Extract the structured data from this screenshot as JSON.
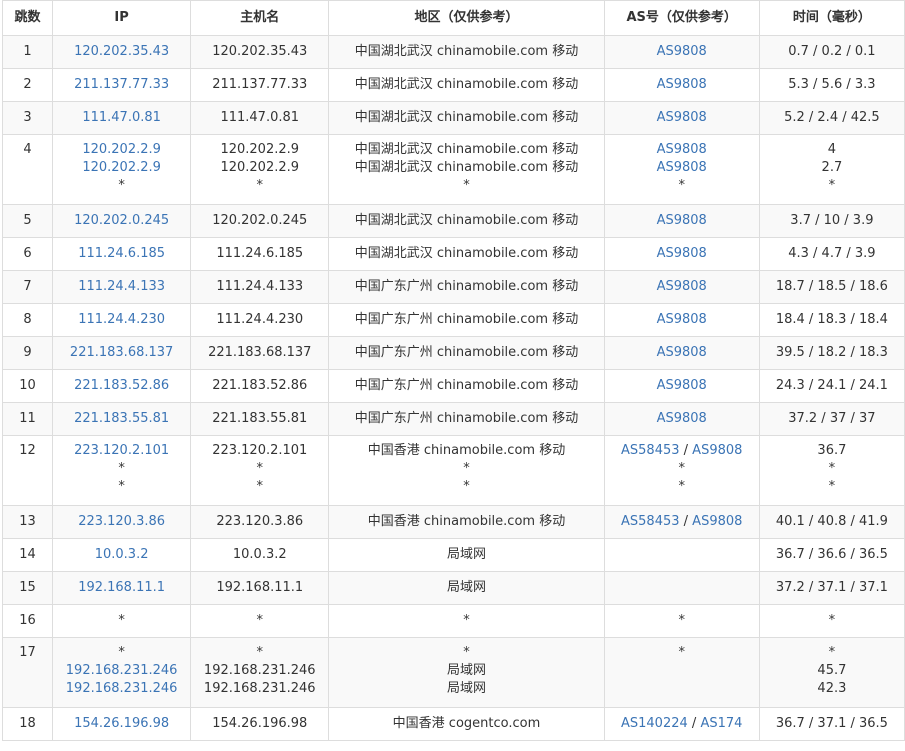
{
  "table": {
    "headers": {
      "hop": "跳数",
      "ip": "IP",
      "hostname": "主机名",
      "region": "地区（仅供参考）",
      "as": "AS号（仅供参考）",
      "time": "时间（毫秒）"
    },
    "rows": [
      {
        "hop": "1",
        "ip": [
          "120.202.35.43"
        ],
        "host": [
          "120.202.35.43"
        ],
        "region": [
          "中国湖北武汉 chinamobile.com 移动"
        ],
        "as": [
          [
            "AS9808"
          ]
        ],
        "time": [
          "0.7 / 0.2 / 0.1"
        ]
      },
      {
        "hop": "2",
        "ip": [
          "211.137.77.33"
        ],
        "host": [
          "211.137.77.33"
        ],
        "region": [
          "中国湖北武汉 chinamobile.com 移动"
        ],
        "as": [
          [
            "AS9808"
          ]
        ],
        "time": [
          "5.3 / 5.6 / 3.3"
        ]
      },
      {
        "hop": "3",
        "ip": [
          "111.47.0.81"
        ],
        "host": [
          "111.47.0.81"
        ],
        "region": [
          "中国湖北武汉 chinamobile.com 移动"
        ],
        "as": [
          [
            "AS9808"
          ]
        ],
        "time": [
          "5.2 / 2.4 / 42.5"
        ]
      },
      {
        "hop": "4",
        "ip": [
          "120.202.2.9",
          "120.202.2.9",
          "*"
        ],
        "host": [
          "120.202.2.9",
          "120.202.2.9",
          "*"
        ],
        "region": [
          "中国湖北武汉 chinamobile.com 移动",
          "中国湖北武汉 chinamobile.com 移动",
          "*"
        ],
        "as": [
          [
            "AS9808"
          ],
          [
            "AS9808"
          ],
          [
            "*"
          ]
        ],
        "time": [
          "4",
          "2.7",
          "*"
        ]
      },
      {
        "hop": "5",
        "ip": [
          "120.202.0.245"
        ],
        "host": [
          "120.202.0.245"
        ],
        "region": [
          "中国湖北武汉 chinamobile.com 移动"
        ],
        "as": [
          [
            "AS9808"
          ]
        ],
        "time": [
          "3.7 / 10 / 3.9"
        ]
      },
      {
        "hop": "6",
        "ip": [
          "111.24.6.185"
        ],
        "host": [
          "111.24.6.185"
        ],
        "region": [
          "中国湖北武汉 chinamobile.com 移动"
        ],
        "as": [
          [
            "AS9808"
          ]
        ],
        "time": [
          "4.3 / 4.7 / 3.9"
        ]
      },
      {
        "hop": "7",
        "ip": [
          "111.24.4.133"
        ],
        "host": [
          "111.24.4.133"
        ],
        "region": [
          "中国广东广州 chinamobile.com 移动"
        ],
        "as": [
          [
            "AS9808"
          ]
        ],
        "time": [
          "18.7 / 18.5 / 18.6"
        ]
      },
      {
        "hop": "8",
        "ip": [
          "111.24.4.230"
        ],
        "host": [
          "111.24.4.230"
        ],
        "region": [
          "中国广东广州 chinamobile.com 移动"
        ],
        "as": [
          [
            "AS9808"
          ]
        ],
        "time": [
          "18.4 / 18.3 / 18.4"
        ]
      },
      {
        "hop": "9",
        "ip": [
          "221.183.68.137"
        ],
        "host": [
          "221.183.68.137"
        ],
        "region": [
          "中国广东广州 chinamobile.com 移动"
        ],
        "as": [
          [
            "AS9808"
          ]
        ],
        "time": [
          "39.5 / 18.2 / 18.3"
        ]
      },
      {
        "hop": "10",
        "ip": [
          "221.183.52.86"
        ],
        "host": [
          "221.183.52.86"
        ],
        "region": [
          "中国广东广州 chinamobile.com 移动"
        ],
        "as": [
          [
            "AS9808"
          ]
        ],
        "time": [
          "24.3 / 24.1 / 24.1"
        ]
      },
      {
        "hop": "11",
        "ip": [
          "221.183.55.81"
        ],
        "host": [
          "221.183.55.81"
        ],
        "region": [
          "中国广东广州 chinamobile.com 移动"
        ],
        "as": [
          [
            "AS9808"
          ]
        ],
        "time": [
          "37.2 / 37 / 37"
        ]
      },
      {
        "hop": "12",
        "ip": [
          "223.120.2.101",
          "*",
          "*"
        ],
        "host": [
          "223.120.2.101",
          "*",
          "*"
        ],
        "region": [
          "中国香港 chinamobile.com 移动",
          "*",
          "*"
        ],
        "as": [
          [
            "AS58453",
            "AS9808"
          ],
          [
            "*"
          ],
          [
            "*"
          ]
        ],
        "time": [
          "36.7",
          "*",
          "*"
        ]
      },
      {
        "hop": "13",
        "ip": [
          "223.120.3.86"
        ],
        "host": [
          "223.120.3.86"
        ],
        "region": [
          "中国香港 chinamobile.com 移动"
        ],
        "as": [
          [
            "AS58453",
            "AS9808"
          ]
        ],
        "time": [
          "40.1 / 40.8 / 41.9"
        ]
      },
      {
        "hop": "14",
        "ip": [
          "10.0.3.2"
        ],
        "host": [
          "10.0.3.2"
        ],
        "region": [
          "局域网"
        ],
        "as": [
          []
        ],
        "time": [
          "36.7 / 36.6 / 36.5"
        ]
      },
      {
        "hop": "15",
        "ip": [
          "192.168.11.1"
        ],
        "host": [
          "192.168.11.1"
        ],
        "region": [
          "局域网"
        ],
        "as": [
          []
        ],
        "time": [
          "37.2 / 37.1 / 37.1"
        ]
      },
      {
        "hop": "16",
        "ip": [
          "*"
        ],
        "host": [
          "*"
        ],
        "region": [
          "*"
        ],
        "as": [
          [
            "*"
          ]
        ],
        "time": [
          "*"
        ]
      },
      {
        "hop": "17",
        "ip": [
          "*",
          "192.168.231.246",
          "192.168.231.246"
        ],
        "host": [
          "*",
          "192.168.231.246",
          "192.168.231.246"
        ],
        "region": [
          "*",
          "局域网",
          "局域网"
        ],
        "as": [
          [
            "*"
          ],
          [],
          []
        ],
        "time": [
          "*",
          "45.7",
          "42.3"
        ]
      },
      {
        "hop": "18",
        "ip": [
          "154.26.196.98"
        ],
        "host": [
          "154.26.196.98"
        ],
        "region": [
          "中国香港 cogentco.com"
        ],
        "as": [
          [
            "AS140224",
            "AS174"
          ]
        ],
        "time": [
          "36.7 / 37.1 / 36.5"
        ]
      }
    ],
    "as_separator": " / ",
    "colors": {
      "link": "#3b74b5",
      "text": "#333333",
      "border": "#dddddd",
      "stripe": "#f9f9f9"
    }
  }
}
